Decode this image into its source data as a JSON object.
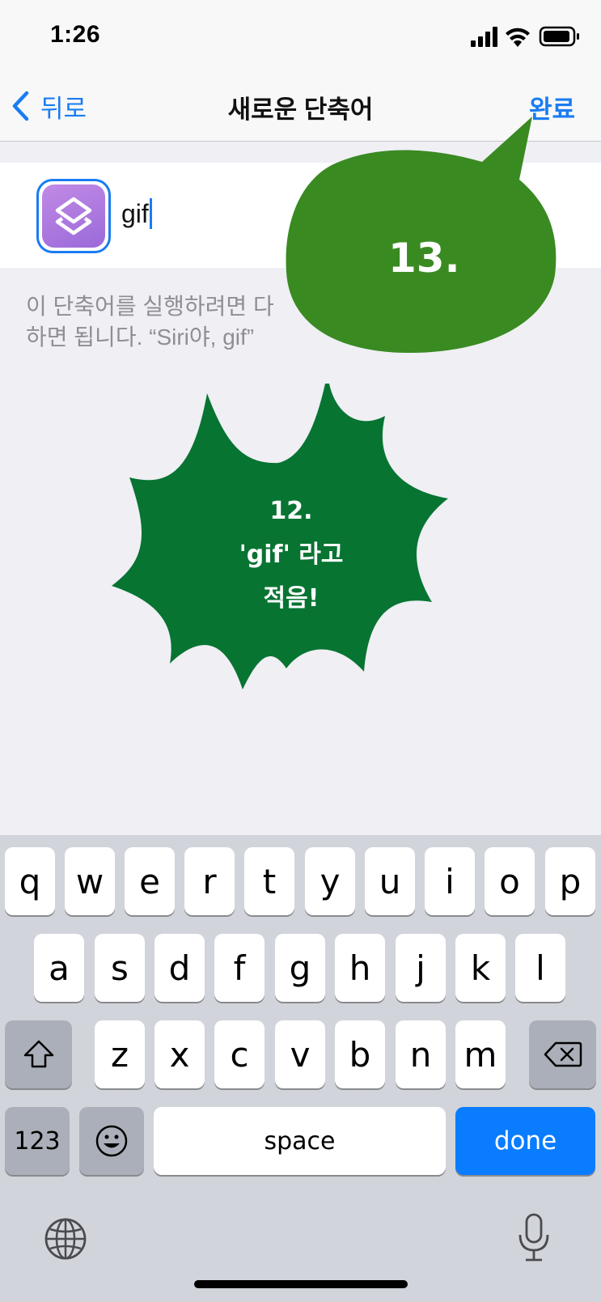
{
  "status": {
    "time": "1:26"
  },
  "nav": {
    "back_label": "뒤로",
    "title": "새로운 단축어",
    "done_label": "완료"
  },
  "shortcut": {
    "name_value": "gif"
  },
  "hint": {
    "line1": "이 단축어를 실행하려면 다",
    "line2": "하면 됩니다. “Siri야, gif”"
  },
  "annotations": {
    "step13": "13.",
    "step12_line1": "12.",
    "step12_line2": "'gif' 라고",
    "step12_line3": "적음!",
    "bubble_color": "#3a8a22",
    "burst_color": "#077432"
  },
  "keyboard": {
    "row1": [
      "q",
      "w",
      "e",
      "r",
      "t",
      "y",
      "u",
      "i",
      "o",
      "p"
    ],
    "row2": [
      "a",
      "s",
      "d",
      "f",
      "g",
      "h",
      "j",
      "k",
      "l"
    ],
    "row3": [
      "z",
      "x",
      "c",
      "v",
      "b",
      "n",
      "m"
    ],
    "numbers_label": "123",
    "space_label": "space",
    "done_label": "done"
  },
  "colors": {
    "accent": "#1a7cf2",
    "keyboard_bg": "#d1d4da"
  }
}
